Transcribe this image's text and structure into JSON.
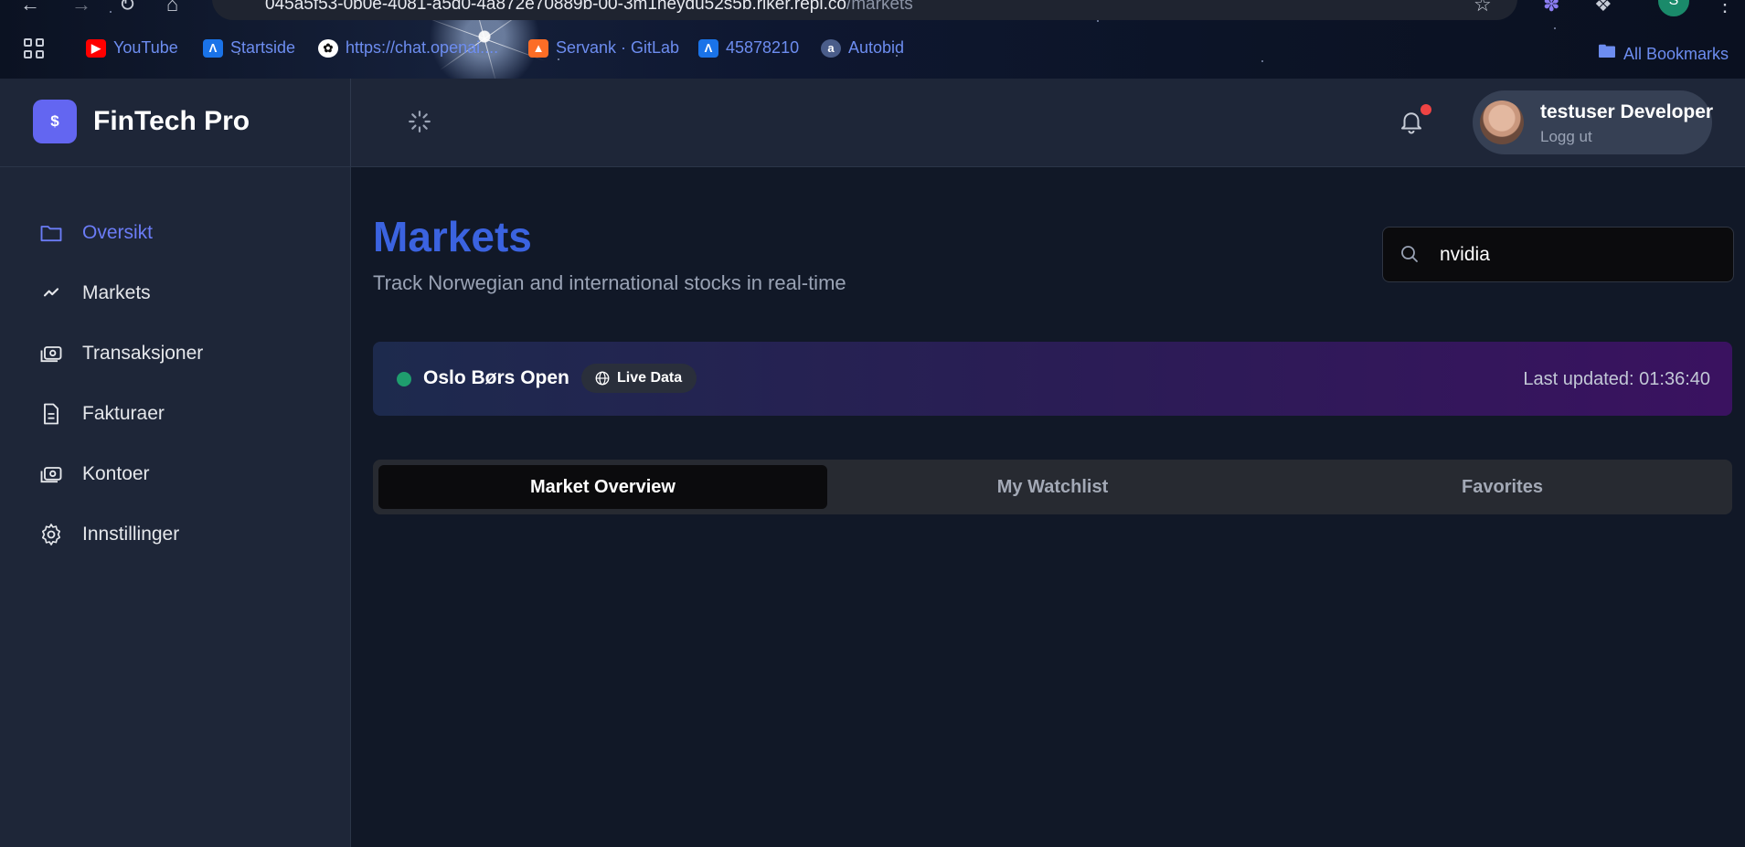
{
  "browser": {
    "url_main": "045a5f53-0b0e-4081-a5d0-4a872e70889b-00-3m1heydu52s5b.riker.repl.co",
    "url_path": "/markets",
    "profile_initial": "S",
    "bookmarks": [
      {
        "label": "YouTube",
        "icon": "youtube-icon",
        "color": "#ff0000"
      },
      {
        "label": "Startside",
        "icon": "startside-icon",
        "color": "#1a73e8"
      },
      {
        "label": "https://chat.openai....",
        "icon": "openai-icon",
        "color": "#ffffff"
      },
      {
        "label": "Servank · GitLab",
        "icon": "gitlab-icon",
        "color": "#fc6d26"
      },
      {
        "label": "45878210",
        "icon": "startside-icon",
        "color": "#1a73e8"
      },
      {
        "label": "Autobid",
        "icon": "autobid-icon",
        "color": "#4a5d8a"
      }
    ],
    "all_bookmarks": "All Bookmarks"
  },
  "app": {
    "brand_symbol": "$",
    "brand_name": "FinTech Pro",
    "accent": "#6366f1"
  },
  "user": {
    "name": "testuser Developer",
    "logout": "Logg ut"
  },
  "sidebar": {
    "items": [
      {
        "label": "Oversikt",
        "icon": "folder-icon",
        "active": true
      },
      {
        "label": "Markets",
        "icon": "trend-icon",
        "active": false
      },
      {
        "label": "Transaksjoner",
        "icon": "cash-icon",
        "active": false
      },
      {
        "label": "Fakturaer",
        "icon": "document-icon",
        "active": false
      },
      {
        "label": "Kontoer",
        "icon": "cash-icon",
        "active": false
      },
      {
        "label": "Innstillinger",
        "icon": "gear-icon",
        "active": false
      }
    ]
  },
  "main": {
    "title": "Markets",
    "subtitle": "Track Norwegian and international stocks in real-time",
    "search_value": "nvidia",
    "status": {
      "text": "Oslo Børs Open",
      "badge": "Live Data",
      "last_updated": "Last updated: 01:36:40",
      "status_color": "#1f9e6e"
    },
    "tabs": [
      {
        "label": "Market Overview",
        "active": true
      },
      {
        "label": "My Watchlist",
        "active": false
      },
      {
        "label": "Favorites",
        "active": false
      }
    ]
  }
}
